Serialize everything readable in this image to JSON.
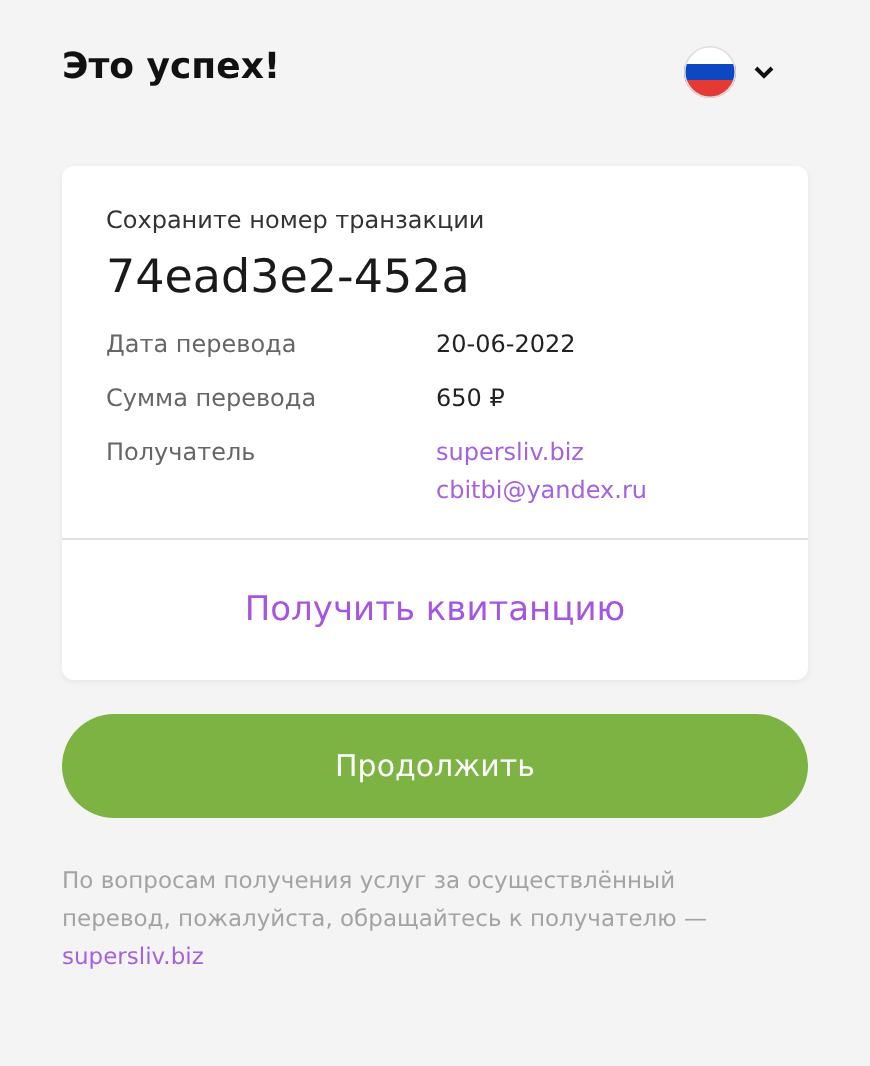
{
  "title": "Это успех!",
  "card": {
    "caption": "Сохраните номер транзакции",
    "transaction_id": "74ead3e2-452a",
    "rows": [
      {
        "label": "Дата перевода",
        "kind": "plain",
        "values": [
          "20-06-2022"
        ]
      },
      {
        "label": "Сумма перевода",
        "kind": "plain",
        "values": [
          "650 ₽"
        ]
      },
      {
        "label": "Получатель",
        "kind": "link",
        "values": [
          "supersliv.biz",
          "cbitbi@yandex.ru"
        ]
      }
    ],
    "receipt_button": "Получить квитанцию"
  },
  "continue_button": "Продолжить",
  "footer": {
    "text": "По вопросам получения услуг за осуществлённый перевод, пожалуйста, обращайтесь к получателю —",
    "link": "supersliv.biz"
  }
}
